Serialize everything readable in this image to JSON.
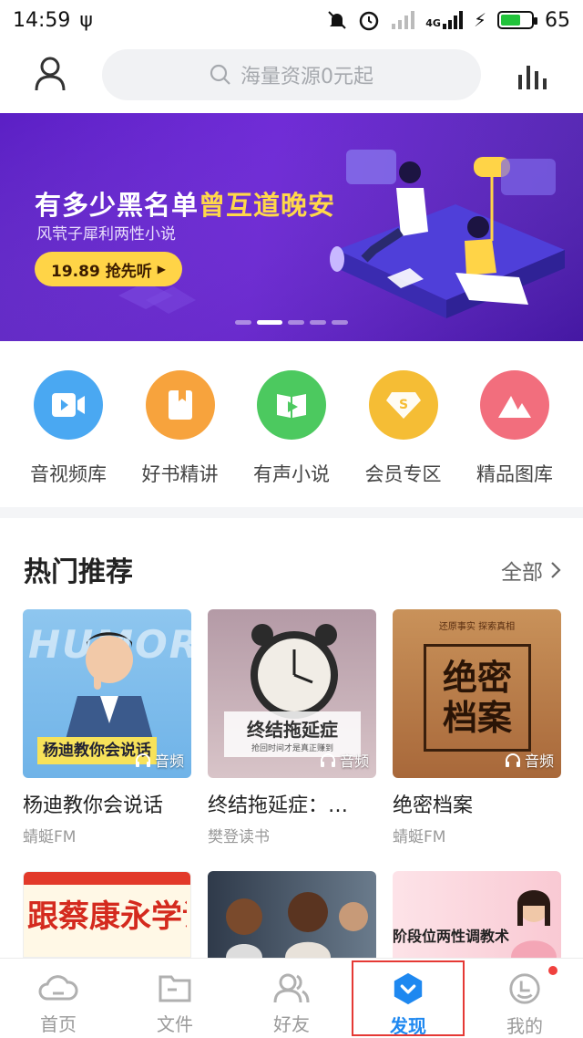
{
  "status_bar": {
    "time": "14:59",
    "battery": "65",
    "battery_level": 0.65,
    "network": "4G"
  },
  "header": {
    "search_placeholder": "海量资源0元起"
  },
  "banner": {
    "title_white": "有多少黑名单",
    "title_highlight": "曾互道晚安",
    "subtitle": "风茕子犀利两性小说",
    "button_label": "19.89 抢先听",
    "active_slide": 2,
    "slide_count": 5
  },
  "categories": [
    {
      "label": "音视频库",
      "icon": "video-library-icon",
      "color": "#4aa8f2"
    },
    {
      "label": "好书精讲",
      "icon": "book-icon",
      "color": "#f7a33d"
    },
    {
      "label": "有声小说",
      "icon": "audio-novel-icon",
      "color": "#4cc95f"
    },
    {
      "label": "会员专区",
      "icon": "vip-diamond-icon",
      "color": "#f5bd35"
    },
    {
      "label": "精品图库",
      "icon": "mountain-image-icon",
      "color": "#f26e7d"
    }
  ],
  "hot": {
    "title": "热门推荐",
    "all_label": "全部",
    "items": [
      {
        "title": "杨迪教你会说话",
        "source": "蜻蜓FM",
        "badge": "音频",
        "cover_text": "杨迪教你会说话",
        "cover_brand": "HUMOR"
      },
      {
        "title": "终结拖延症：…",
        "source": "樊登读书",
        "badge": "音频",
        "cover_text": "终结拖延症",
        "cover_sub": "抢回时间才是真正赚到"
      },
      {
        "title": "绝密档案",
        "source": "蜻蜓FM",
        "badge": "音频",
        "cover_text": "绝密档案",
        "cover_top": "还原事实 探索真相"
      }
    ],
    "more_items": [
      {
        "cover_text": "跟蔡康永学说话"
      },
      {
        "cover_text": ""
      },
      {
        "cover_text": "阶段位两性调教术"
      }
    ]
  },
  "bottom_nav": [
    {
      "label": "首页",
      "icon": "home-cloud-icon"
    },
    {
      "label": "文件",
      "icon": "folder-icon"
    },
    {
      "label": "好友",
      "icon": "friends-icon"
    },
    {
      "label": "发现",
      "icon": "discover-icon",
      "active": true
    },
    {
      "label": "我的",
      "icon": "profile-face-icon",
      "has_dot": true
    }
  ]
}
